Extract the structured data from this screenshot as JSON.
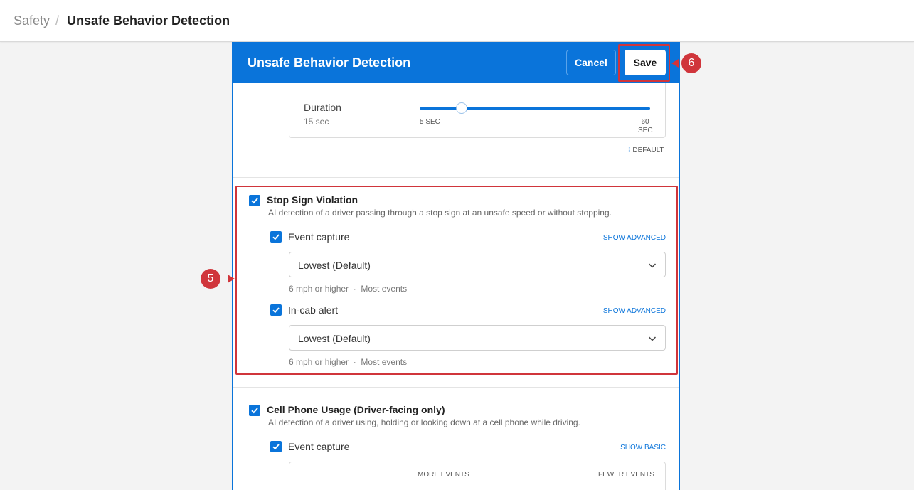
{
  "breadcrumb": {
    "root": "Safety",
    "separator": "/",
    "current": "Unsafe Behavior Detection"
  },
  "panel": {
    "title": "Unsafe Behavior Detection",
    "cancel_label": "Cancel",
    "save_label": "Save"
  },
  "duration": {
    "label": "Duration",
    "value": "15 sec",
    "slider_min": "5 SEC",
    "slider_max_line1": "60",
    "slider_max_line2": "SEC",
    "slider_value_sec": 15,
    "default_label": "DEFAULT"
  },
  "stop_sign": {
    "title": "Stop Sign Violation",
    "description": "AI detection of a driver passing through a stop sign at an unsafe speed or without stopping.",
    "event_capture": {
      "label": "Event capture",
      "advanced_link": "SHOW ADVANCED",
      "selected": "Lowest (Default)",
      "hint_speed": "6 mph or higher",
      "hint_sep": "·",
      "hint_events": "Most events"
    },
    "in_cab": {
      "label": "In-cab alert",
      "advanced_link": "SHOW ADVANCED",
      "selected": "Lowest (Default)",
      "hint_speed": "6 mph or higher",
      "hint_sep": "·",
      "hint_events": "Most events"
    }
  },
  "cell_phone": {
    "title": "Cell Phone Usage (Driver-facing only)",
    "description": "AI detection of a driver using, holding or looking down at a cell phone while driving.",
    "event_capture": {
      "label": "Event capture",
      "basic_link": "SHOW BASIC",
      "more_label": "MORE EVENTS",
      "fewer_label": "FEWER EVENTS"
    }
  },
  "markers": {
    "step5": "5",
    "step6": "6"
  },
  "colors": {
    "accent": "#0a74da",
    "highlight": "#d0353b"
  }
}
